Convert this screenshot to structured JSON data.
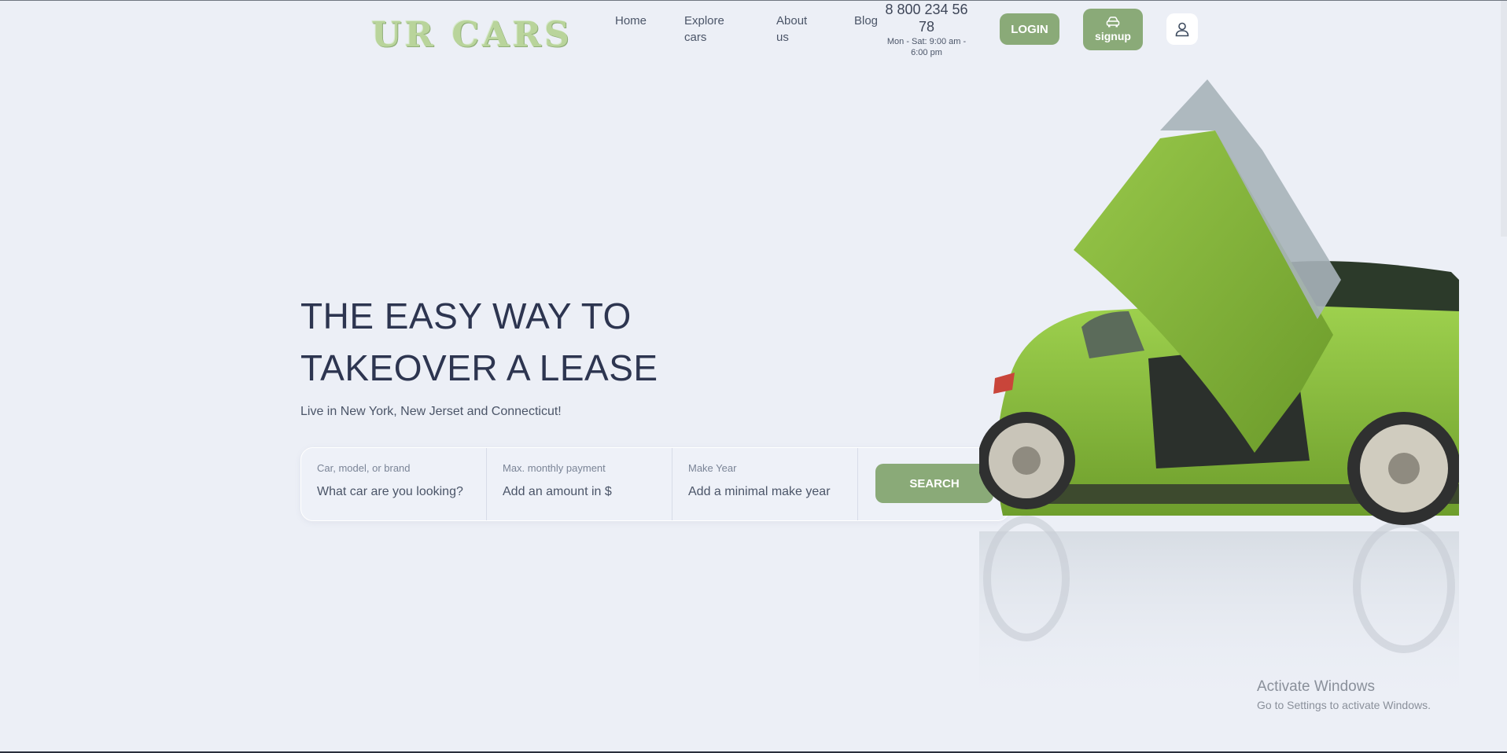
{
  "header": {
    "logo": "UR CARS",
    "nav": {
      "home": "Home",
      "explore": "Explore cars",
      "about": "About us",
      "blog": "Blog"
    },
    "phone_number": "8 800 234 56 78",
    "phone_hours": "Mon - Sat: 9:00 am - 6:00 pm",
    "login_label": "LOGIN",
    "signup_label": "signup"
  },
  "hero": {
    "title": "THE EASY WAY TO TAKEOVER A LEASE",
    "subtitle": "Live in New York, New Jerset and Connecticut!"
  },
  "search": {
    "fields": [
      {
        "label": "Car, model, or brand",
        "placeholder": "What car are you looking?"
      },
      {
        "label": "Max. monthly payment",
        "placeholder": "Add an amount in $"
      },
      {
        "label": "Make Year",
        "placeholder": "Add a minimal make year"
      }
    ],
    "button_label": "SEARCH"
  },
  "watermark": {
    "title": "Activate Windows",
    "subtitle": "Go to Settings to activate Windows."
  },
  "colors": {
    "background": "#eceff6",
    "accent": "#8aaa78",
    "heading": "#2d3550",
    "car": "#8cc23c"
  },
  "icons": [
    "car-icon",
    "user-icon"
  ]
}
